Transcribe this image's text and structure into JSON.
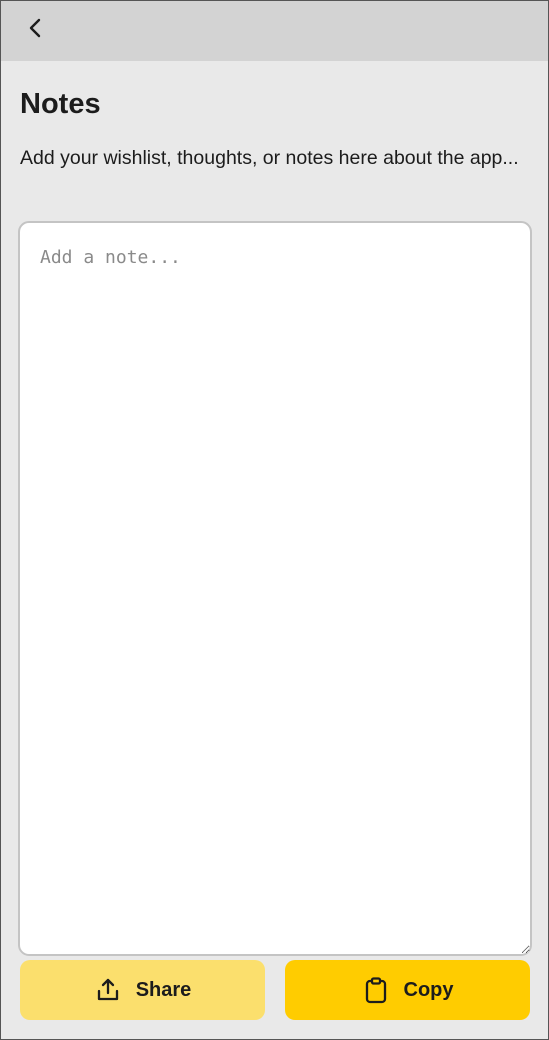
{
  "header": {
    "back_icon": "chevron-left-icon"
  },
  "page": {
    "title": "Notes",
    "description": "Add your wishlist, thoughts, or notes here about the app..."
  },
  "note": {
    "value": "",
    "placeholder": "Add a note..."
  },
  "actions": {
    "share_label": "Share",
    "share_icon": "share-upload-icon",
    "share_color": "#fbdf6d",
    "copy_label": "Copy",
    "copy_icon": "clipboard-icon",
    "copy_color": "#ffcc00"
  }
}
